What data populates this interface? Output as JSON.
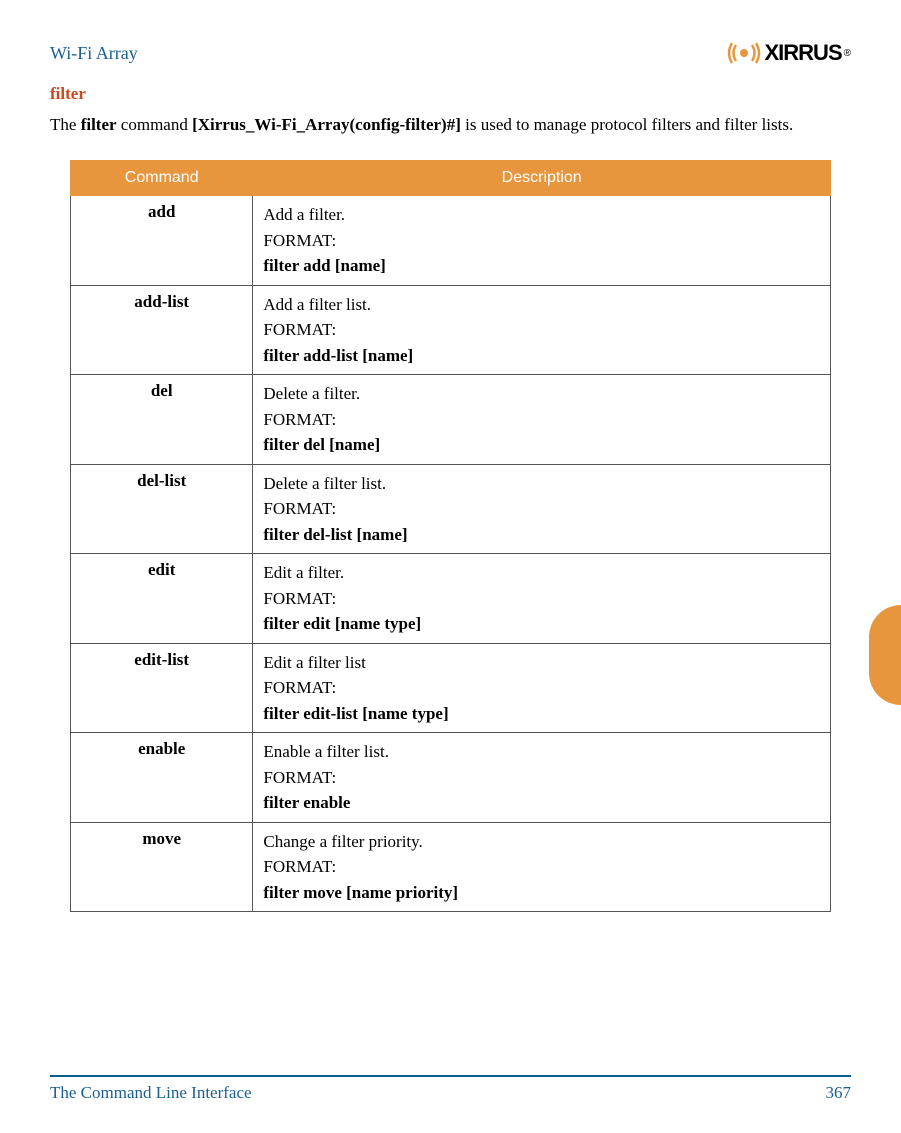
{
  "header": {
    "title": "Wi-Fi Array",
    "brand": "XIRRUS"
  },
  "section_title": "filter",
  "intro": {
    "prefix": "The ",
    "bold1": "filter",
    "middle1": " command ",
    "bold2": "[Xirrus_Wi-Fi_Array(config-filter)#]",
    "suffix": " is used to manage protocol filters and filter lists."
  },
  "table": {
    "headers": {
      "command": "Command",
      "description": "Description"
    },
    "rows": [
      {
        "command": "add",
        "description": "Add a filter.",
        "format_label": "FORMAT:",
        "format": "filter add [name]"
      },
      {
        "command": "add-list",
        "description": "Add a filter list.",
        "format_label": "FORMAT:",
        "format": "filter add-list [name]"
      },
      {
        "command": "del",
        "description": "Delete a filter.",
        "format_label": "FORMAT:",
        "format": "filter del [name]"
      },
      {
        "command": "del-list",
        "description": "Delete a filter list.",
        "format_label": "FORMAT:",
        "format": "filter del-list [name]"
      },
      {
        "command": "edit",
        "description": "Edit a filter.",
        "format_label": "FORMAT:",
        "format": "filter edit [name type]"
      },
      {
        "command": "edit-list",
        "description": "Edit a filter list",
        "format_label": "FORMAT:",
        "format": "filter edit-list [name type]"
      },
      {
        "command": "enable",
        "description": "Enable a filter list.",
        "format_label": "FORMAT:",
        "format": "filter enable"
      },
      {
        "command": "move",
        "description": "Change a filter priority.",
        "format_label": "FORMAT:",
        "format": "filter move [name priority]"
      }
    ]
  },
  "footer": {
    "left": "The Command Line Interface",
    "right": "367"
  }
}
